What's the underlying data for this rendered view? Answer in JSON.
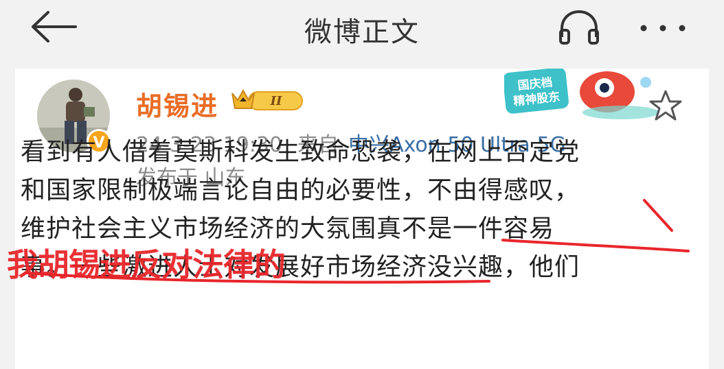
{
  "header": {
    "title": "微博正文",
    "back_icon": "arrow-left-icon",
    "listen_icon": "headphones-icon",
    "more_icon": "more-dots-icon"
  },
  "post": {
    "author": "胡锡进",
    "vip_badge": "II",
    "verified_badge": "V",
    "sticker_text": "国庆档 精神股东",
    "time": "24-3-23 19:30",
    "source_prefix": "来自",
    "device": "中兴Axon 50 Ultra 5G",
    "location": "发布于 山东",
    "lines": [
      "看到有人借着莫斯科发生致命恐袭，在网上否定党",
      "和国家限制极端言论自由的必要性，不由得感叹，",
      "维护社会主义市场经济的大氛围真不是一件容易",
      "事。一些激进人士对发展好市场经济没兴趣，他们"
    ]
  },
  "annotation": {
    "overlay_text": "我胡锡进反对法律的",
    "color": "#e8262b"
  },
  "colors": {
    "accent": "#e96d26",
    "link": "#3a6fa6",
    "meta": "#8c8c8c"
  }
}
